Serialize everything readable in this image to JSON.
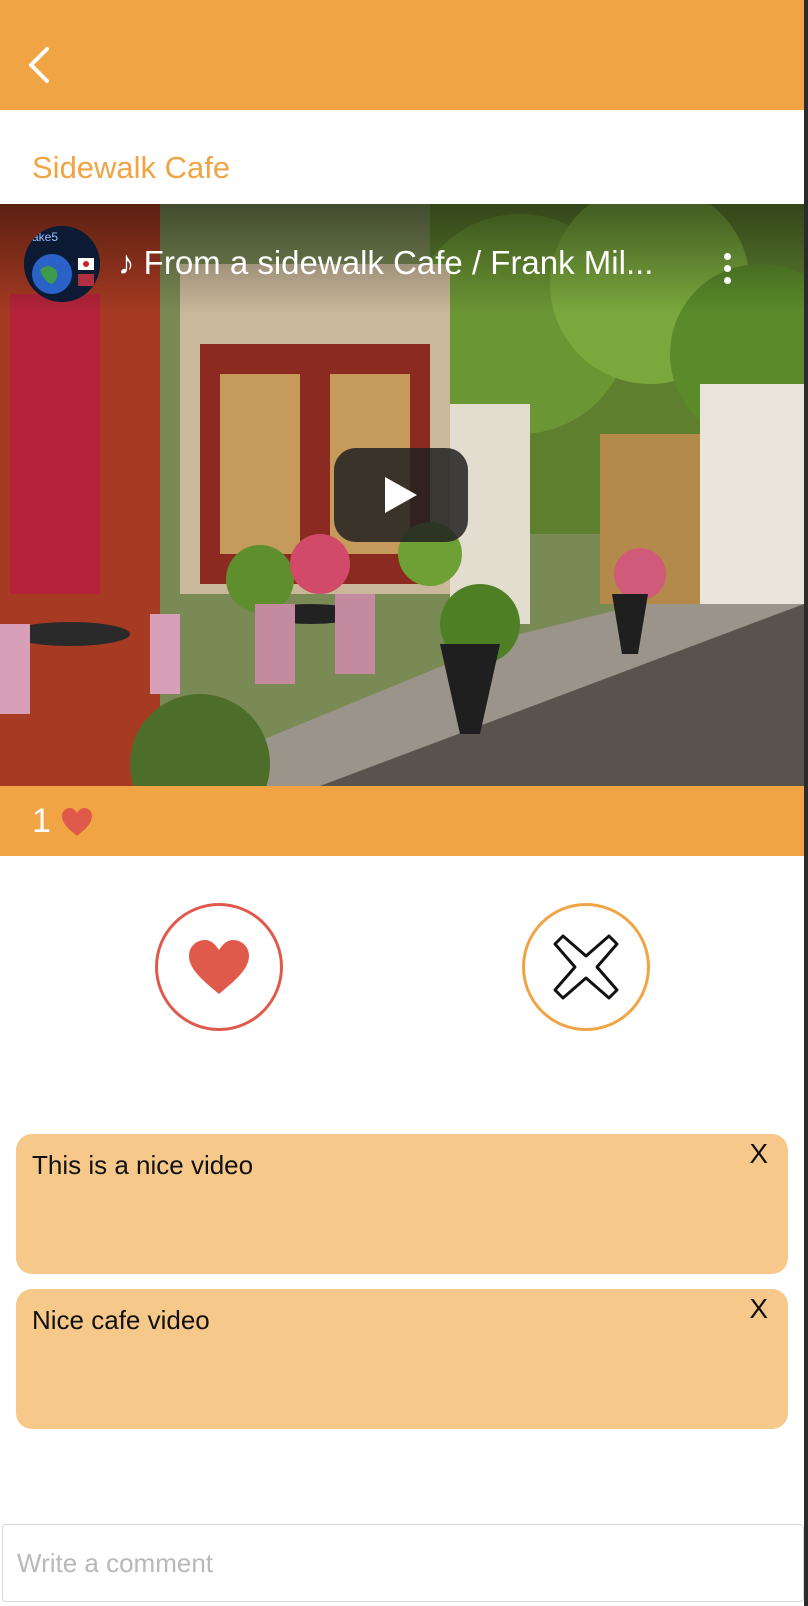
{
  "header": {
    "back_icon": "chevron-left-icon",
    "background": "#f0a443"
  },
  "page": {
    "title": "Sidewalk Cafe"
  },
  "video": {
    "title": "♪ From a sidewalk Cafe / Frank Mil...",
    "channel_avatar_text": "ake5",
    "play_icon": "play-icon",
    "menu_icon": "more-vertical-icon"
  },
  "likes": {
    "count": "1",
    "icon": "heart-icon"
  },
  "actions": {
    "like_icon": "heart-icon",
    "dislike_icon": "x-icon"
  },
  "comments": [
    {
      "text": "This is a nice video",
      "close_label": "X"
    },
    {
      "text": "Nice cafe video",
      "close_label": "X"
    }
  ],
  "comment_input": {
    "placeholder": "Write a comment",
    "value": ""
  },
  "colors": {
    "accent": "#f0a443",
    "heart": "#e05a4c",
    "comment_bg": "#f6c98a"
  }
}
